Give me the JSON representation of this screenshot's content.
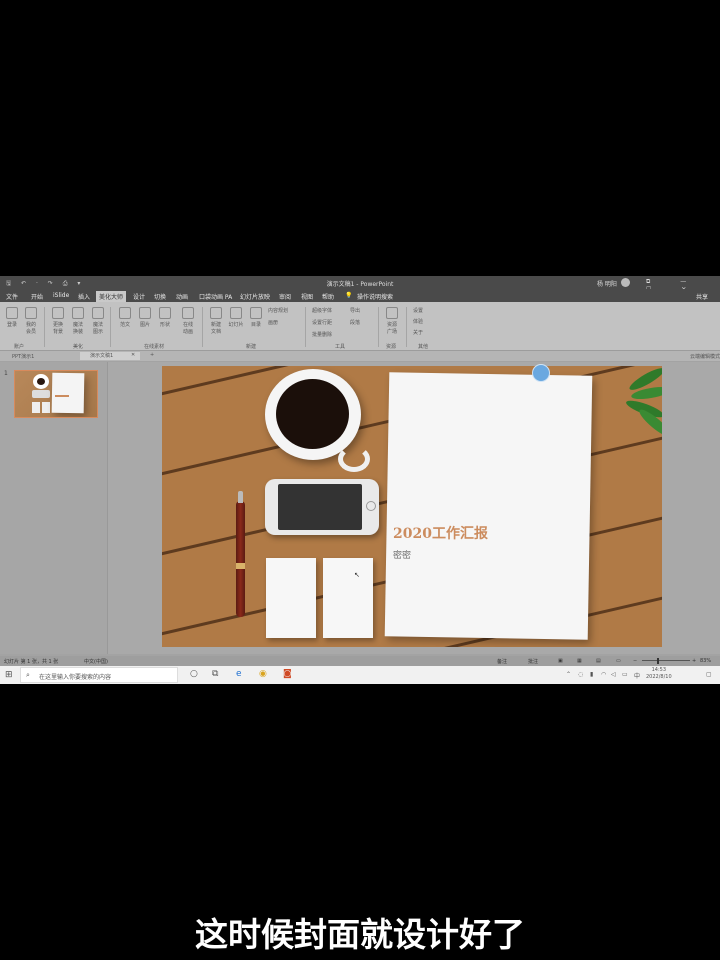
{
  "app": {
    "doc_title": "演示文稿1 - PowerPoint",
    "user_name": "杨 明阳",
    "quick_access": "🖫 ↶ · ↷ ⎙ ▾",
    "window_buttons": "⧉ — ☐ ✕"
  },
  "menu": {
    "items": [
      "文件",
      "开始",
      "iSlide",
      "插入",
      "美化大师",
      "设计",
      "切换",
      "动画",
      "口袋动画 PA",
      "幻灯片放映",
      "审阅",
      "视图",
      "帮助"
    ],
    "active_index": 4,
    "tell_me": "操作说明搜索",
    "share": "共享"
  },
  "ribbon": {
    "buttons": [
      {
        "label": "登录"
      },
      {
        "label": "我的\n会员"
      },
      {
        "label": "更换\n背景"
      },
      {
        "label": "魔法\n换装"
      },
      {
        "label": "魔法\n图示"
      },
      {
        "label": "范文"
      },
      {
        "label": "图片"
      },
      {
        "label": "形状"
      },
      {
        "label": "在线\n动画"
      },
      {
        "label": "新建\n文档"
      },
      {
        "label": "幻灯片"
      },
      {
        "label": "目录"
      },
      {
        "label": "资源\n广场"
      }
    ],
    "small": [
      "内容规划",
      "画册",
      "超级字体",
      "导出",
      "设置行距",
      "段落",
      "批量删除",
      "设置",
      "体验",
      "关于"
    ],
    "groups": [
      "账户",
      "美化",
      "在线素材",
      "新建",
      "工具",
      "资源",
      "其他"
    ]
  },
  "tabs": {
    "inactive": "PPT演示1",
    "active": "演示文稿1",
    "right": "云端编辑模式"
  },
  "slide_panel": {
    "number": "1"
  },
  "slide": {
    "title": "2020工作汇报",
    "subtitle": "密密"
  },
  "status": {
    "slide_info": "幻灯片 第 1 张，共 1 张",
    "language": "中文(中国)",
    "notes": "备注",
    "comments": "批注",
    "zoom": "83%"
  },
  "taskbar": {
    "search_placeholder": "在这里输入你要搜索的内容",
    "time": "14:53",
    "date": "2022/8/10",
    "ime": "中"
  },
  "caption": "这时候封面就设计好了",
  "colors": {
    "accent_title": "#cc8c5e",
    "ribbon_bg": "#c2c2c2",
    "titlebar_bg": "#4a4a4a"
  }
}
